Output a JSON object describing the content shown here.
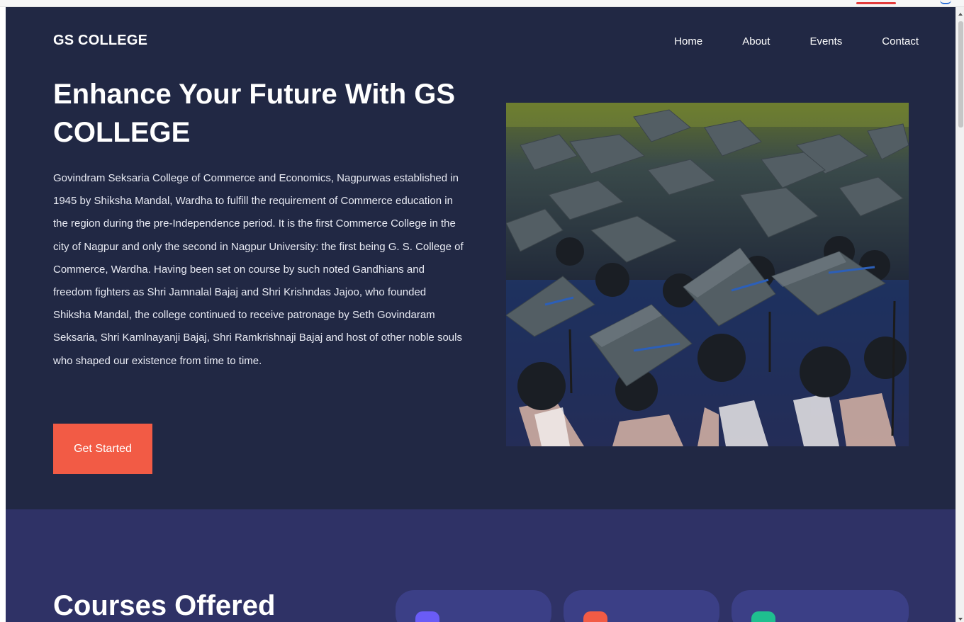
{
  "header": {
    "brand": "GS COLLEGE",
    "nav": [
      "Home",
      "About",
      "Events",
      "Contact"
    ]
  },
  "hero": {
    "title": "Enhance Your Future With GS COLLEGE",
    "paragraph": "Govindram Seksaria College of Commerce and Economics, Nagpurwas established in 1945 by Shiksha Mandal, Wardha to fulfill the requirement of Commerce education in the region during the pre-Independence period. It is the first Commerce College in the city of Nagpur and only the second in Nagpur University: the first being G. S. College of Commerce, Wardha. Having been set on course by such noted Gandhians and freedom fighters as Shri Jamnalal Bajaj and Shri Krishndas Jajoo, who founded Shiksha Mandal, the college continued to receive patronage by Seth Govindaram Seksaria, Shri Kamlnayanji Bajaj, Shri Ramkrishnaji Bajaj and host of other noble souls who shaped our existence from time to time.",
    "cta_label": "Get Started"
  },
  "courses": {
    "title": "Courses Offered",
    "card_badge_colors": [
      "#6a5cf6",
      "#f25b45",
      "#1fbf8f"
    ]
  },
  "colors": {
    "hero_bg": "#212844",
    "courses_bg": "#2f3266",
    "cta": "#f25b45",
    "card_bg": "#3b3f86"
  }
}
